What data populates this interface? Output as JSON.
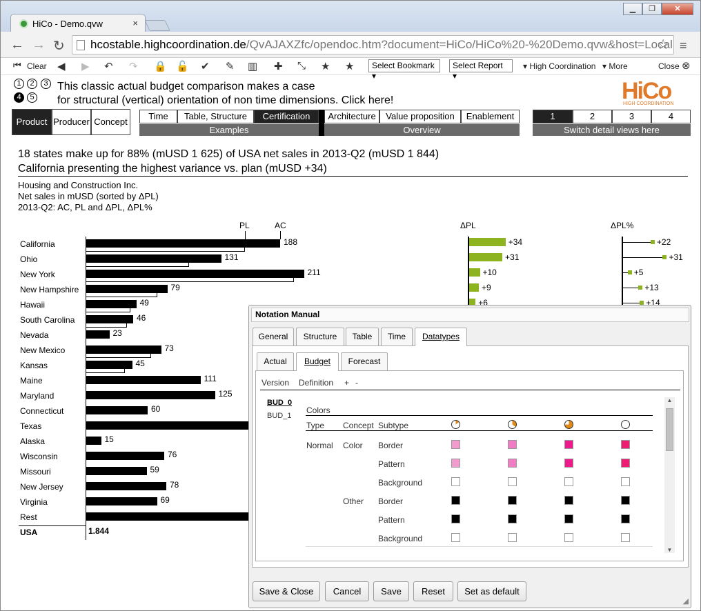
{
  "browser": {
    "tab_title": "HiCo - Demo.qvw",
    "tab_close": "×",
    "url_host": "hcostable.highcoordination.de",
    "url_path": "/QvAJAXZfc/opendoc.htm?document=HiCo/HiCo%20-%20Demo.qvw&host=Local"
  },
  "toolbar": {
    "clear": "Clear",
    "select_bookmark": "Select Bookmark",
    "select_report": "Select Report",
    "high_coordination": "High Coordination",
    "more": "More",
    "close": "Close"
  },
  "app": {
    "steps": [
      "1",
      "2",
      "3",
      "4",
      "5"
    ],
    "intro_line1": "This classic actual budget comparison makes a case",
    "intro_line2": "for structural (vertical) orientation of non time dimensions. Click here!",
    "logo_text": "HiCo",
    "logo_sub": "HIGH COORDINATION",
    "nav_left": [
      "Product",
      "Producer",
      "Concept"
    ],
    "examples_tabs": [
      "Time",
      "Table, Structure",
      "Certification"
    ],
    "examples_label": "Examples",
    "overview_tabs": [
      "Architecture",
      "Value proposition",
      "Enablement"
    ],
    "overview_label": "Overview",
    "detail_tabs": [
      "1",
      "2",
      "3",
      "4"
    ],
    "detail_label": "Switch detail views here",
    "headline1": "18 states make up for 88% (mUSD 1 625) of USA net sales in 2013-Q2 (mUSD 1 844)",
    "headline2": "California presenting the highest variance vs. plan (mUSD +34)",
    "company": "Housing and Construction Inc.",
    "measure": "Net sales in mUSD (sorted by ΔPL)",
    "period": "2013-Q2: AC, PL and ΔPL, ΔPL%"
  },
  "chart_data": {
    "type": "bar",
    "legend_pl": "PL",
    "legend_ac": "AC",
    "dpl_title": "ΔPL",
    "dplp_title": "ΔPL%",
    "categories": [
      "California",
      "Ohio",
      "New York",
      "New Hampshire",
      "Hawaii",
      "South Carolina",
      "Nevada",
      "New Mexico",
      "Kansas",
      "Maine",
      "Maryland",
      "Connecticut",
      "Texas",
      "Alaska",
      "Wisconsin",
      "Missouri",
      "New Jersey",
      "Virginia",
      "Rest"
    ],
    "ac": [
      188,
      131,
      211,
      79,
      49,
      46,
      23,
      73,
      45,
      111,
      125,
      60,
      null,
      15,
      76,
      59,
      78,
      69,
      null
    ],
    "pl": [
      154,
      100,
      201,
      69,
      43,
      40,
      null,
      63,
      38,
      null,
      null,
      null,
      null,
      null,
      null,
      null,
      null,
      null,
      null
    ],
    "ac_labels": [
      "188",
      "131",
      "211",
      "79",
      "49",
      "46",
      "23",
      "73",
      "45",
      "111",
      "125",
      "60",
      "",
      "15",
      "76",
      "59",
      "78",
      "69",
      ""
    ],
    "dpl_labels": [
      "+34",
      "+31",
      "+10",
      "+9",
      "+6"
    ],
    "dpl": [
      34,
      31,
      10,
      9,
      6
    ],
    "dplp_labels": [
      "+22",
      "+31",
      "+5",
      "+13",
      "+14"
    ],
    "dplp": [
      22,
      31,
      5,
      13,
      14
    ],
    "total_label": "USA",
    "total_value": "1.844"
  },
  "dialog": {
    "title": "Notation Manual",
    "tabs": [
      "General",
      "Structure",
      "Table",
      "Time",
      "Datatypes"
    ],
    "subtabs": [
      "Actual",
      "Budget",
      "Forecast"
    ],
    "toolbar": [
      "Version",
      "Definition",
      "+",
      "-"
    ],
    "versions": [
      "BUD_0",
      "BUD_1"
    ],
    "section": "Colors",
    "headers": [
      "Type",
      "Concept",
      "Subtype"
    ],
    "type_normal": "Normal",
    "concept_color": "Color",
    "concept_other": "Other",
    "subtypes": [
      "Border",
      "Pattern",
      "Background",
      "Border",
      "Pattern",
      "Background"
    ],
    "colors": {
      "pink1": "#f29bcf",
      "pink2": "#f07cc4",
      "pink3": "#ee1a8c",
      "pink4": "#ee1b72",
      "black": "#000000",
      "white": "#ffffff",
      "accent_green": "#8db31f"
    },
    "buttons": [
      "Save & Close",
      "Cancel",
      "Save",
      "Reset",
      "Set as default"
    ]
  }
}
